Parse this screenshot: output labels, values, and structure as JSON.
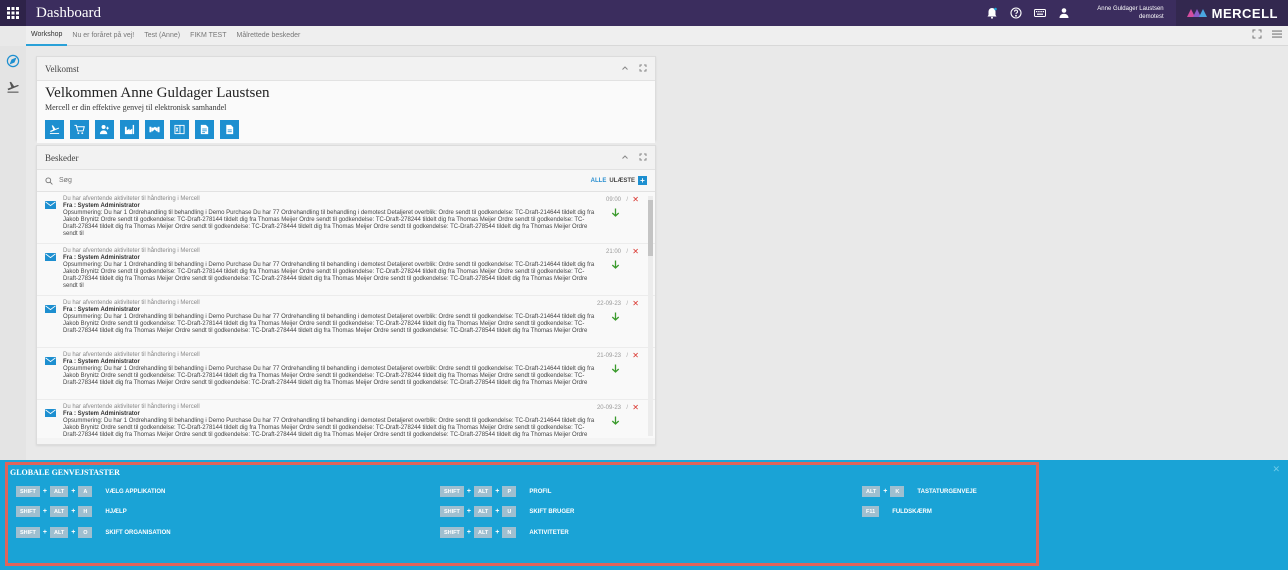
{
  "topbar": {
    "title": "Dashboard",
    "user_name": "Anne Guldager Laustsen",
    "user_org": "demotest",
    "brand": "MERCELL"
  },
  "tabs": [
    {
      "label": "Workshop",
      "active": true
    },
    {
      "label": "Nu er foråret på vej!",
      "active": false
    },
    {
      "label": "Test (Anne)",
      "active": false
    },
    {
      "label": "FIKM TEST",
      "active": false
    },
    {
      "label": "Målrettede beskeder",
      "active": false
    }
  ],
  "welcome": {
    "header": "Velkomst",
    "title": "Velkommen Anne Guldager Laustsen",
    "subtitle": "Mercell er din effektive genvej til elektronisk samhandel",
    "quick_icons": [
      "plane-icon",
      "cart-icon",
      "user-add-icon",
      "factory-icon",
      "handshake-icon",
      "excel-icon",
      "document-icon",
      "file-icon"
    ]
  },
  "messages": {
    "header": "Beskeder",
    "search_placeholder": "Søg",
    "filter_all": "ALLE",
    "filter_unread": "ULÆSTE",
    "items": [
      {
        "subject": "Du har afventende aktiviteter til håndtering i Mercell",
        "from": "Fra : System Administrator",
        "body": "Opsummering: Du har 1 Ordrehandling til behandling i Demo Purchase Du har 77 Ordrehandling til behandling i demotest Detaljeret overblik: Ordre sendt til godkendelse: TC-Draft-214644 tildelt dig fra Jakob Brynitz Ordre sendt til godkendelse: TC-Draft-278144 tildelt dig fra Thomas Meijer Ordre sendt til godkendelse: TC-Draft-278244 tildelt dig fra Thomas Meijer Ordre sendt til godkendelse: TC-Draft-278344 tildelt dig fra Thomas Meijer Ordre sendt til godkendelse: TC-Draft-278444 tildelt dig fra Thomas Meijer Ordre sendt til godkendelse: TC-Draft-278544 tildelt dig fra Thomas Meijer Ordre sendt til",
        "date": "09:00"
      },
      {
        "subject": "Du har afventende aktiviteter til håndtering i Mercell",
        "from": "Fra : System Administrator",
        "body": "Opsummering: Du har 1 Ordrehandling til behandling i Demo Purchase Du har 77 Ordrehandling til behandling i demotest Detaljeret overblik: Ordre sendt til godkendelse: TC-Draft-214644 tildelt dig fra Jakob Brynitz Ordre sendt til godkendelse: TC-Draft-278144 tildelt dig fra Thomas Meijer Ordre sendt til godkendelse: TC-Draft-278244 tildelt dig fra Thomas Meijer Ordre sendt til godkendelse: TC-Draft-278344 tildelt dig fra Thomas Meijer Ordre sendt til godkendelse: TC-Draft-278444 tildelt dig fra Thomas Meijer Ordre sendt til godkendelse: TC-Draft-278544 tildelt dig fra Thomas Meijer Ordre sendt til",
        "date": "21:00"
      },
      {
        "subject": "Du har afventende aktiviteter til håndtering i Mercell",
        "from": "Fra : System Administrator",
        "body": "Opsummering: Du har 1 Ordrehandling til behandling i Demo Purchase Du har 77 Ordrehandling til behandling i demotest Detaljeret overblik: Ordre sendt til godkendelse: TC-Draft-214644 tildelt dig fra Jakob Brynitz Ordre sendt til godkendelse: TC-Draft-278144 tildelt dig fra Thomas Meijer Ordre sendt til godkendelse: TC-Draft-278244 tildelt dig fra Thomas Meijer Ordre sendt til godkendelse: TC-Draft-278344 tildelt dig fra Thomas Meijer Ordre sendt til godkendelse: TC-Draft-278444 tildelt dig fra Thomas Meijer Ordre sendt til godkendelse: TC-Draft-278544 tildelt dig fra Thomas Meijer Ordre",
        "date": "22-09-23"
      },
      {
        "subject": "Du har afventende aktiviteter til håndtering i Mercell",
        "from": "Fra : System Administrator",
        "body": "Opsummering: Du har 1 Ordrehandling til behandling i Demo Purchase Du har 77 Ordrehandling til behandling i demotest Detaljeret overblik: Ordre sendt til godkendelse: TC-Draft-214644 tildelt dig fra Jakob Brynitz Ordre sendt til godkendelse: TC-Draft-278144 tildelt dig fra Thomas Meijer Ordre sendt til godkendelse: TC-Draft-278244 tildelt dig fra Thomas Meijer Ordre sendt til godkendelse: TC-Draft-278344 tildelt dig fra Thomas Meijer Ordre sendt til godkendelse: TC-Draft-278444 tildelt dig fra Thomas Meijer Ordre sendt til godkendelse: TC-Draft-278544 tildelt dig fra Thomas Meijer Ordre",
        "date": "21-09-23"
      },
      {
        "subject": "Du har afventende aktiviteter til håndtering i Mercell",
        "from": "Fra : System Administrator",
        "body": "Opsummering: Du har 1 Ordrehandling til behandling i Demo Purchase Du har 77 Ordrehandling til behandling i demotest Detaljeret overblik: Ordre sendt til godkendelse: TC-Draft-214644 tildelt dig fra Jakob Brynitz Ordre sendt til godkendelse: TC-Draft-278144 tildelt dig fra Thomas Meijer Ordre sendt til godkendelse: TC-Draft-278244 tildelt dig fra Thomas Meijer Ordre sendt til godkendelse: TC-Draft-278344 tildelt dig fra Thomas Meijer Ordre sendt til godkendelse: TC-Draft-278444 tildelt dig fra Thomas Meijer Ordre sendt til godkendelse: TC-Draft-278544 tildelt dig fra Thomas Meijer Ordre sendt til",
        "date": "20-09-23"
      }
    ]
  },
  "shortcuts": {
    "title": "GLOBALE GENVEJSTASTER",
    "items": [
      {
        "keys": [
          "SHIFT",
          "ALT",
          "A"
        ],
        "label": "VÆLG APPLIKATION"
      },
      {
        "keys": [
          "SHIFT",
          "ALT",
          "H"
        ],
        "label": "HJÆLP"
      },
      {
        "keys": [
          "SHIFT",
          "ALT",
          "O"
        ],
        "label": "SKIFT ORGANISATION"
      },
      {
        "keys": [
          "SHIFT",
          "ALT",
          "P"
        ],
        "label": "PROFIL"
      },
      {
        "keys": [
          "SHIFT",
          "ALT",
          "U"
        ],
        "label": "SKIFT BRUGER"
      },
      {
        "keys": [
          "SHIFT",
          "ALT",
          "N"
        ],
        "label": "AKTIVITETER"
      },
      {
        "keys": [
          "ALT",
          "K"
        ],
        "label": "TASTATURGENVEJE"
      },
      {
        "keys": [
          "F11"
        ],
        "label": "FULDSKÆRM"
      }
    ]
  },
  "colors": {
    "topbar": "#3b2d5e",
    "accent": "#1d8fd0",
    "shortcut_panel": "#1aa3d6",
    "highlight_frame": "#e0645a",
    "delete": "#d9312a",
    "arrow": "#3a9a2c"
  }
}
